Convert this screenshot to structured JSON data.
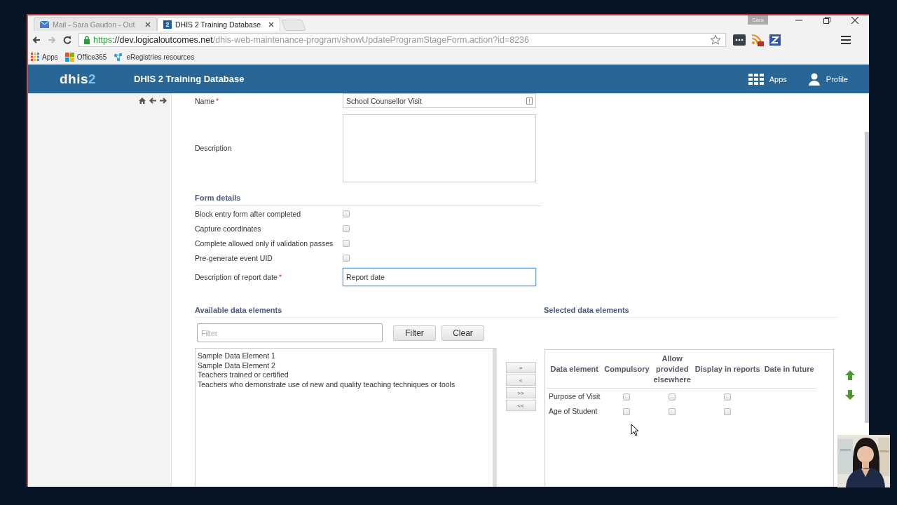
{
  "browser": {
    "tabs": [
      {
        "title": "Mail - Sara Gaudon - Out",
        "selected": false,
        "kind": "mail"
      },
      {
        "title": "DHIS 2 Training Database",
        "selected": true,
        "kind": "app",
        "badge": "2"
      }
    ],
    "window_user": "Sara",
    "url": {
      "scheme": "https",
      "host": "://dev.logicaloutcomes.net",
      "path": "/dhis-web-maintenance-program/showUpdateProgramStageForm.action?id=8236"
    },
    "bookmarks": [
      {
        "label": "Apps",
        "kind": "apps"
      },
      {
        "label": "Office365",
        "kind": "office"
      },
      {
        "label": "eRegistries resources",
        "kind": "network"
      }
    ]
  },
  "header": {
    "logo": {
      "word": "dhis",
      "digit": "2"
    },
    "title": "DHIS 2 Training Database",
    "menu": [
      {
        "label": "Apps",
        "kind": "apps"
      },
      {
        "label": "Profile",
        "kind": "profile"
      }
    ]
  },
  "form": {
    "fields": [
      {
        "kind": "text",
        "label": "Name",
        "mark": "*",
        "value": "School Counsellor Visit"
      },
      {
        "kind": "textarea",
        "label": "Description"
      }
    ],
    "section": "Form details",
    "options": [
      {
        "label": "Block entry form after completed",
        "checked": false
      },
      {
        "label": "Capture coordinates",
        "checked": false
      },
      {
        "label": "Complete allowed only if validation passes",
        "checked": false
      },
      {
        "label": "Pre-generate event UID",
        "checked": false
      }
    ],
    "report_date": {
      "label": "Description of report date",
      "mark": "*",
      "value": "Report date",
      "focused": true
    }
  },
  "available": {
    "heading": "Available data elements",
    "filter": {
      "placeholder": "Filter"
    },
    "buttons": [
      "Filter",
      "Clear"
    ],
    "items": [
      "Sample Data Element 1",
      "Sample Data Element 2",
      "Teachers trained or certified",
      "Teachers who demonstrate use of new and quality teaching techniques or tools"
    ]
  },
  "move_buttons": [
    ">",
    "<",
    ">>",
    "<<"
  ],
  "selected": {
    "heading": "Selected data elements",
    "columns": [
      "Data element",
      "Compulsory",
      "Allow provided elsewhere",
      "Display in reports",
      "Date in future"
    ],
    "rows": [
      {
        "name": "Purpose of Visit",
        "compulsory": false,
        "allow_provided_elsewhere": false,
        "display_in_reports": false
      },
      {
        "name": "Age of Student",
        "compulsory": false,
        "allow_provided_elsewhere": false,
        "display_in_reports": false
      }
    ]
  },
  "webcam": {
    "kind": "picture"
  }
}
